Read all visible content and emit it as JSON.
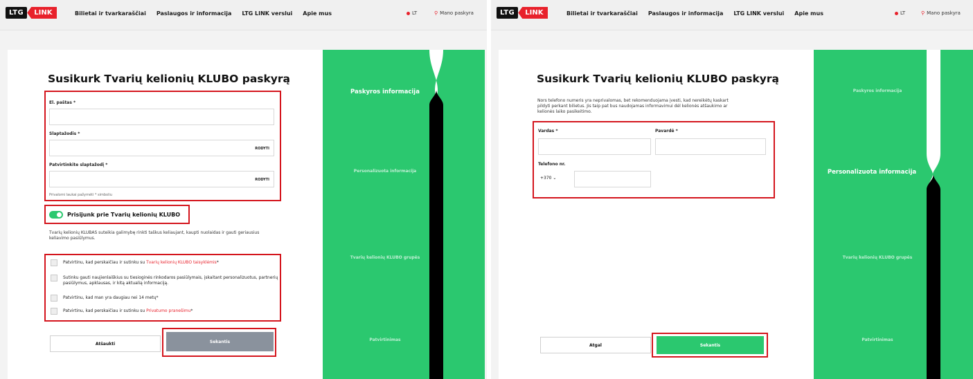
{
  "header": {
    "logo_ltg": "LTG",
    "logo_link": "LINK",
    "nav": [
      "Bilietai ir tvarkaraščiai",
      "Paslaugos ir informacija",
      "LTG LINK verslui",
      "Apie mus"
    ],
    "lang": "LT",
    "account": "Mano paskyra"
  },
  "screen1": {
    "title": "Susikurk Tvarių kelionių KLUBO paskyrą",
    "email_label": "El. paštas *",
    "email_value": "",
    "password_label": "Slaptažodis *",
    "password_value": "",
    "show_label": "RODYTI",
    "confirm_label": "Patvirtinkite slaptažodį *",
    "confirm_value": "",
    "required_hint": "Privalomi laukai pažymėti * simboliu",
    "club_toggle_label": "Prisijunk prie Tvarių kelionių KLUBO",
    "club_description": "Tvarių kelionių KLUBAS suteikia galimybę rinkti taškus keliaujant, kaupti nuolaidas ir gauti geriausius keliavimo pasiūlymus.",
    "checkboxes": [
      {
        "text": "Patvirtinu, kad perskaičiau ir sutinku su ",
        "link": "Tvarių kelionių KLUBO taisyklėmis",
        "suffix": "*"
      },
      {
        "text": "Sutinku gauti naujienlaiškius su tiesioginės rinkodaros pasiūlymais, įskaitant personalizuotus, partnerių pasiūlymus, apklausas, ir kitą aktualią informaciją.",
        "link": "",
        "suffix": ""
      },
      {
        "text": "Patvirtinu, kad man yra daugiau nei 14 metų*",
        "link": "",
        "suffix": ""
      },
      {
        "text": "Patvirtinu, kad perskaičiau ir sutinku su ",
        "link": "Privatumo pranešimu",
        "suffix": "*"
      }
    ],
    "cancel_button": "Atšaukti",
    "next_button": "Sekantis",
    "steps": [
      "Paskyros informacija",
      "Personalizuota informacija",
      "Tvarių kelionių KLUBO grupės",
      "Patvirtinimas"
    ],
    "active_step": 0
  },
  "screen2": {
    "title": "Susikurk Tvarių kelionių KLUBO paskyrą",
    "intro": "Nors telefono numeris yra neprivalomas, bet rekomenduojama įvesti, kad nereikėtų kaskart pildyti perkant bilietus. Jis taip pat bus naudojamas informavimui dėl kelionės atšaukimo ar kelionės laiko pasikeitimo.",
    "first_name_label": "Vardas *",
    "first_name_value": "",
    "last_name_label": "Pavardė *",
    "last_name_value": "",
    "phone_label": "Telefono nr.",
    "dial_code": "+370",
    "phone_value": "",
    "back_button": "Atgal",
    "next_button": "Sekantis",
    "steps": [
      "Paskyros informacija",
      "Personalizuota informacija",
      "Tvarių kelionių KLUBO grupės",
      "Patvirtinimas"
    ],
    "active_step": 1
  },
  "colors": {
    "brand_red": "#e8212b",
    "club_green": "#2bc86f",
    "disabled_grey": "#8a929d",
    "highlight_red": "#d4141c"
  }
}
